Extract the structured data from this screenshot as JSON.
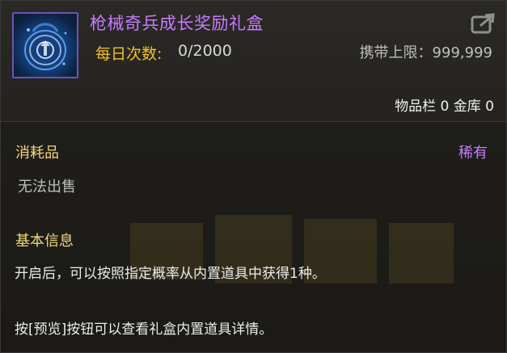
{
  "item": {
    "name": "枪械奇兵成长奖励礼盒",
    "icon": "gift-pouch-icon",
    "daily_label": "每日次数:",
    "daily_value": "0/2000",
    "carry_limit": "携带上限：999,999",
    "storage_counts": "物品栏 0 金库 0",
    "category": "消耗品",
    "rarity": "稀有",
    "trade_status": "无法出售",
    "info_title": "基本信息",
    "desc_1": "开启后，可以按照指定概率从内置道具中获得1种。",
    "desc_2": "按[预览]按钮可以查看礼盒内置道具详情。"
  },
  "colors": {
    "name": "#c77bff",
    "rarity": "#c77bff",
    "daily_label": "#f2c12c",
    "section_title": "#f2d77a",
    "icon_border": "#6a55b8"
  }
}
